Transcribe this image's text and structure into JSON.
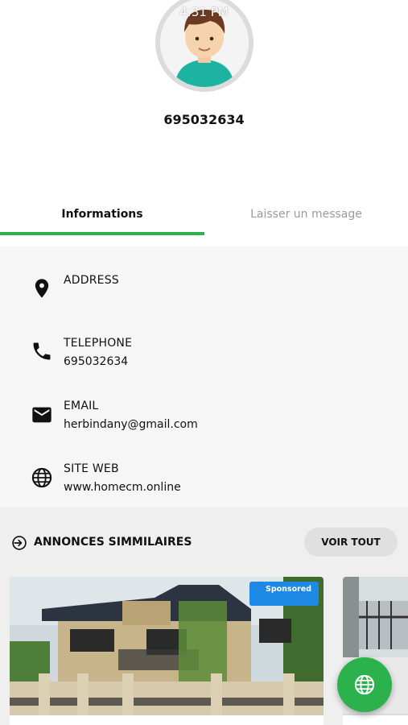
{
  "status_bar": {
    "time": "4:31 PM"
  },
  "profile": {
    "title": "695032634"
  },
  "tabs": [
    {
      "label": "Informations"
    },
    {
      "label": "Laisser un message"
    }
  ],
  "info": {
    "address": {
      "label": "ADDRESS",
      "value": ""
    },
    "telephone": {
      "label": "TELEPHONE",
      "value": "695032634"
    },
    "email": {
      "label": "EMAIL",
      "value": "herbindany@gmail.com"
    },
    "website": {
      "label": "SITE WEB",
      "value": "www.homecm.online"
    }
  },
  "similar": {
    "title": "ANNONCES SIMMILAIRES",
    "see_all_label": "VOIR TOUT",
    "cards": [
      {
        "badge": "Sponsored",
        "image": "two-story-house-photo"
      },
      {
        "image": "house-balcony-photo"
      }
    ]
  },
  "fab": {
    "icon": "globe-icon"
  },
  "colors": {
    "accent": "#2bb24c",
    "badge": "#1e88e5"
  }
}
